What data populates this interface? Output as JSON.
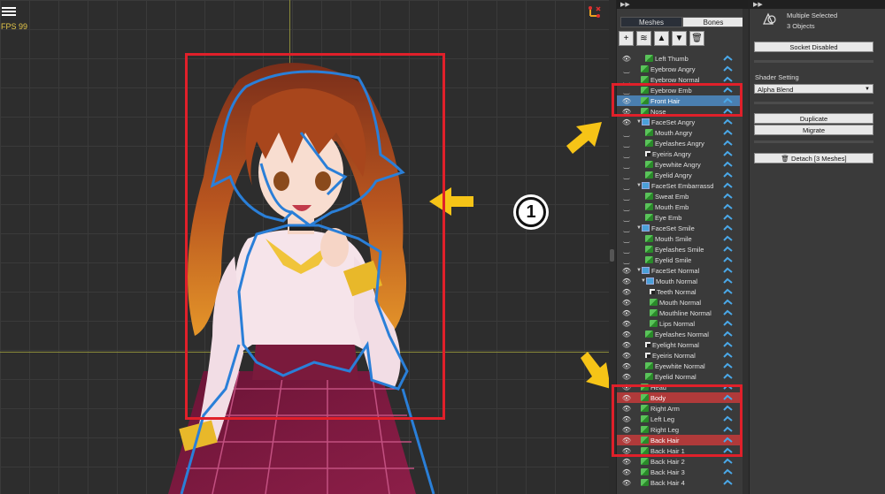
{
  "viewport": {
    "fps": "FPS 99",
    "badge_number": "1"
  },
  "hierarchy": {
    "tabs": [
      {
        "label": "Meshes",
        "active": true
      },
      {
        "label": "Bones",
        "active": false
      }
    ],
    "toolbar": [
      {
        "icon": "plus-icon",
        "glyph": "+"
      },
      {
        "icon": "layers-icon",
        "glyph": "≋"
      },
      {
        "icon": "move-up-icon",
        "glyph": "▲"
      },
      {
        "icon": "move-down-icon",
        "glyph": "▼"
      },
      {
        "icon": "trash-icon",
        "glyph": "🗑"
      }
    ],
    "rows": [
      {
        "label": "Left Thumb",
        "depth": 2,
        "vis": "eye",
        "icon": "mesh",
        "state": ""
      },
      {
        "label": "Eyebrow Angry",
        "depth": 1,
        "vis": "closed",
        "icon": "mesh",
        "state": ""
      },
      {
        "label": "Eyebrow Normal",
        "depth": 1,
        "vis": "closed",
        "icon": "mesh",
        "state": ""
      },
      {
        "label": "Eyebrow Emb",
        "depth": 1,
        "vis": "closed",
        "icon": "mesh",
        "state": ""
      },
      {
        "label": "Front Hair",
        "depth": 1,
        "vis": "eye",
        "icon": "mesh",
        "state": "blue"
      },
      {
        "label": "Nose",
        "depth": 1,
        "vis": "eye",
        "icon": "mesh",
        "state": ""
      },
      {
        "label": "FaceSet Angry",
        "depth": 0,
        "vis": "eye",
        "icon": "group",
        "state": "",
        "expand": "▼"
      },
      {
        "label": "Mouth Angry",
        "depth": 2,
        "vis": "closed",
        "icon": "mesh",
        "state": ""
      },
      {
        "label": "Eyelashes Angry",
        "depth": 2,
        "vis": "closed",
        "icon": "mesh",
        "state": ""
      },
      {
        "label": "Eyeiris Angry",
        "depth": 2,
        "vis": "closed",
        "icon": "bone",
        "state": ""
      },
      {
        "label": "Eyewhite Angry",
        "depth": 2,
        "vis": "closed",
        "icon": "mesh",
        "state": ""
      },
      {
        "label": "Eyelid Angry",
        "depth": 2,
        "vis": "closed",
        "icon": "mesh",
        "state": ""
      },
      {
        "label": "FaceSet Embarrassd",
        "depth": 0,
        "vis": "closed",
        "icon": "group",
        "state": "",
        "expand": "▼"
      },
      {
        "label": "Sweat Emb",
        "depth": 2,
        "vis": "closed",
        "icon": "mesh",
        "state": ""
      },
      {
        "label": "Mouth Emb",
        "depth": 2,
        "vis": "closed",
        "icon": "mesh",
        "state": ""
      },
      {
        "label": "Eye Emb",
        "depth": 2,
        "vis": "closed",
        "icon": "mesh",
        "state": ""
      },
      {
        "label": "FaceSet Smile",
        "depth": 0,
        "vis": "closed",
        "icon": "group",
        "state": "",
        "expand": "▼"
      },
      {
        "label": "Mouth Smile",
        "depth": 2,
        "vis": "closed",
        "icon": "mesh",
        "state": ""
      },
      {
        "label": "Eyelashes Smile",
        "depth": 2,
        "vis": "closed",
        "icon": "mesh",
        "state": ""
      },
      {
        "label": "Eyelid Smile",
        "depth": 2,
        "vis": "closed",
        "icon": "mesh",
        "state": ""
      },
      {
        "label": "FaceSet Normal",
        "depth": 0,
        "vis": "eye",
        "icon": "group",
        "state": "",
        "expand": "▼"
      },
      {
        "label": "Mouth Normal",
        "depth": 1,
        "vis": "eye",
        "icon": "group",
        "state": "",
        "expand": "▼"
      },
      {
        "label": "Teeth Normal",
        "depth": 3,
        "vis": "eye",
        "icon": "bone",
        "state": ""
      },
      {
        "label": "Mouth Normal",
        "depth": 3,
        "vis": "eye",
        "icon": "mesh",
        "state": ""
      },
      {
        "label": "Mouthline Normal",
        "depth": 3,
        "vis": "eye",
        "icon": "mesh",
        "state": ""
      },
      {
        "label": "Lips Normal",
        "depth": 3,
        "vis": "eye",
        "icon": "mesh",
        "state": ""
      },
      {
        "label": "Eyelashes Normal",
        "depth": 2,
        "vis": "eye",
        "icon": "mesh",
        "state": ""
      },
      {
        "label": "Eyelight Normal",
        "depth": 2,
        "vis": "eye",
        "icon": "bone",
        "state": ""
      },
      {
        "label": "Eyeiris Normal",
        "depth": 2,
        "vis": "eye",
        "icon": "bone",
        "state": ""
      },
      {
        "label": "Eyewhite Normal",
        "depth": 2,
        "vis": "eye",
        "icon": "mesh",
        "state": ""
      },
      {
        "label": "Eyelid Normal",
        "depth": 2,
        "vis": "eye",
        "icon": "mesh",
        "state": ""
      },
      {
        "label": "Head",
        "depth": 1,
        "vis": "eye",
        "icon": "mesh",
        "state": ""
      },
      {
        "label": "Body",
        "depth": 1,
        "vis": "eye",
        "icon": "mesh",
        "state": "red"
      },
      {
        "label": "Right Arm",
        "depth": 1,
        "vis": "eye",
        "icon": "mesh",
        "state": ""
      },
      {
        "label": "Left Leg",
        "depth": 1,
        "vis": "eye",
        "icon": "mesh",
        "state": ""
      },
      {
        "label": "Right Leg",
        "depth": 1,
        "vis": "eye",
        "icon": "mesh",
        "state": ""
      },
      {
        "label": "Back Hair",
        "depth": 1,
        "vis": "eye",
        "icon": "mesh",
        "state": "red"
      },
      {
        "label": "Back Hair 1",
        "depth": 1,
        "vis": "eye",
        "icon": "mesh",
        "state": ""
      },
      {
        "label": "Back Hair 2",
        "depth": 1,
        "vis": "eye",
        "icon": "mesh",
        "state": ""
      },
      {
        "label": "Back Hair 3",
        "depth": 1,
        "vis": "eye",
        "icon": "mesh",
        "state": ""
      },
      {
        "label": "Back Hair 4",
        "depth": 1,
        "vis": "eye",
        "icon": "mesh",
        "state": ""
      }
    ]
  },
  "inspector": {
    "title": "Multiple Selected",
    "subtitle": "3 Objects",
    "socket_button": "Socket Disabled",
    "shader_label": "Shader Setting",
    "shader_value": "Alpha Blend",
    "duplicate_button": "Duplicate",
    "migrate_button": "Migrate",
    "detach_button": "Detach [3 Meshes]"
  },
  "colors": {
    "highlight_red": "#e0202a",
    "outline_blue": "#2a7fd8",
    "arrow_yellow": "#f6c417",
    "selected_blue": "#4a7fb0",
    "selected_red": "#b03a3a"
  }
}
